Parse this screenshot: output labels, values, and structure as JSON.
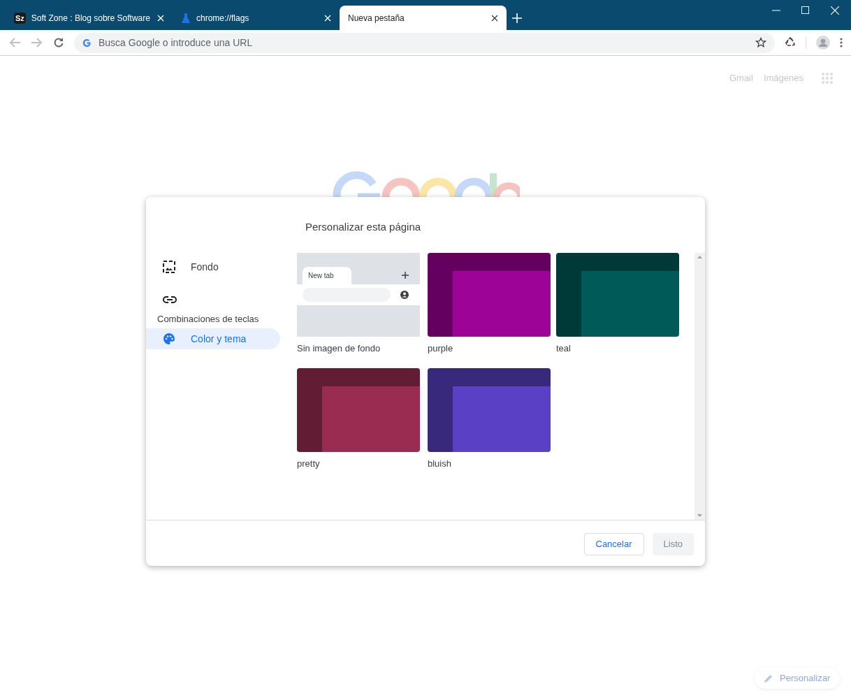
{
  "tabs": [
    {
      "title": "Soft Zone : Blog sobre Software",
      "kind": "site",
      "favicon_text": "Sz",
      "selected": false
    },
    {
      "title": "chrome://flags",
      "kind": "flags",
      "selected": false
    },
    {
      "title": "Nueva pestaña",
      "kind": "newtab",
      "selected": true
    }
  ],
  "omnibox": {
    "placeholder": "Busca Google o introduce una URL"
  },
  "top_links": [
    "Gmail",
    "Imágenes"
  ],
  "dialog": {
    "title": "Personalizar esta página",
    "menu": [
      {
        "label": "Fondo",
        "kind": "background",
        "selected": false
      },
      {
        "label": "Combinaciones de teclas",
        "kind": "shortcuts",
        "selected": false
      },
      {
        "label": "Color y tema",
        "kind": "theme",
        "selected": true
      }
    ],
    "themes": [
      {
        "label": "Sin imagen de fondo",
        "kind": "default",
        "preview_tab": "New tab"
      },
      {
        "label": "purple",
        "kind": "color",
        "color": "#9d0396"
      },
      {
        "label": "teal",
        "kind": "color",
        "color": "#005b58"
      },
      {
        "label": "pretty",
        "kind": "color",
        "color": "#992c50"
      },
      {
        "label": "bluish",
        "kind": "color",
        "color": "#5940c4"
      }
    ],
    "buttons": [
      {
        "label": "Cancelar",
        "kind": "secondary"
      },
      {
        "label": "Listo",
        "kind": "disabled"
      }
    ]
  },
  "customize_button": "Personalizar"
}
